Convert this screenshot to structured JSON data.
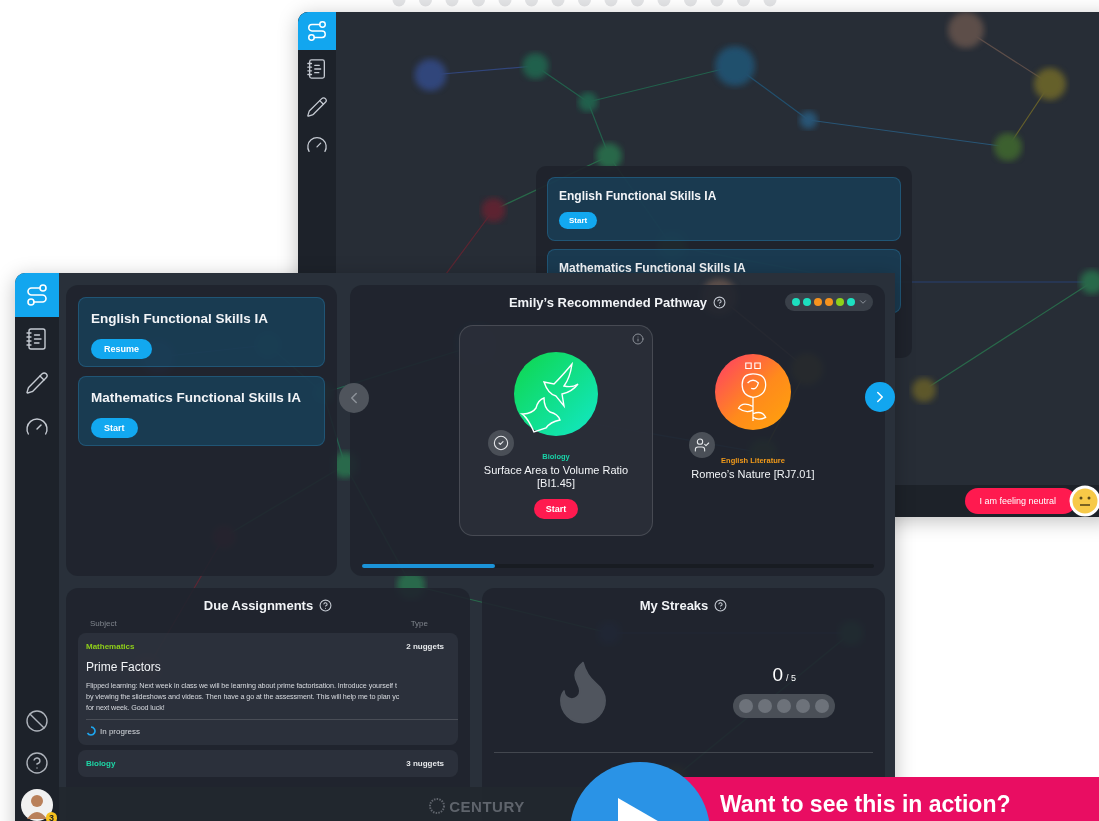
{
  "back_window": {
    "sidebar": [
      {
        "selected": true
      },
      {
        "selected": false
      },
      {
        "selected": false
      },
      {
        "selected": false
      }
    ],
    "courses": [
      {
        "title": "English Functional Skills IA",
        "button": "Start"
      },
      {
        "title": "Mathematics Functional Skills IA"
      }
    ],
    "mood": {
      "label": "I am feeling neutral"
    }
  },
  "front_window": {
    "sidebar": [
      {
        "selected": true
      },
      {
        "selected": false
      },
      {
        "selected": false
      },
      {
        "selected": false
      }
    ],
    "avatar": {
      "badge": "3"
    },
    "courses": [
      {
        "title": "English Functional Skills IA",
        "button": "Resume"
      },
      {
        "title": "Mathematics Functional Skills IA",
        "button": "Start"
      }
    ],
    "pathway": {
      "title": "Emily’s Recommended Pathway",
      "progress_dots": [
        {
          "color": "#1de0c0"
        },
        {
          "color": "#1de0c0"
        },
        {
          "color": "#f7931e"
        },
        {
          "color": "#f7931e"
        },
        {
          "color": "#8fd11a"
        },
        {
          "color": "#1de0c0"
        }
      ],
      "prev": {
        "disabled": true
      },
      "next": {
        "disabled": false
      },
      "cards": [
        {
          "subject": "Biology",
          "color": "#19d3a8",
          "title": "Surface Area to Volume Ratio [BI1.45]",
          "selected": true,
          "button": "Start"
        },
        {
          "subject": "English Literature",
          "color": "#f29a1a",
          "title": "Romeo’s Nature [RJ7.01]",
          "selected": false
        }
      ],
      "level": 0.26
    },
    "assignments": {
      "title": "Due Assignments",
      "columns": [
        "Subject",
        "Type"
      ],
      "items": [
        {
          "subject": "Mathematics",
          "color": "#8fcf1a",
          "type": "2 nuggets",
          "title": "Prime Factors",
          "description": "Flipped learning: Next week in class we will be learning about prime factorisation. Introduce yourself t\nby viewing the slideshows and videos. Then have a go at the assessment. This will help me to plan yc\nfor next week. Good luck!",
          "status": "In progress"
        },
        {
          "subject": "Biology",
          "color": "#1ed6a6",
          "type": "3 nuggets"
        }
      ]
    },
    "streaks": {
      "title": "My Streaks",
      "count": "0",
      "total": "/ 5",
      "days": [
        {
          "done": false
        },
        {
          "done": false
        },
        {
          "done": false
        },
        {
          "done": false
        },
        {
          "done": false
        }
      ]
    },
    "footer": {
      "logo": "CENTURY"
    }
  },
  "cta": {
    "label": "Want to see this in action?"
  }
}
